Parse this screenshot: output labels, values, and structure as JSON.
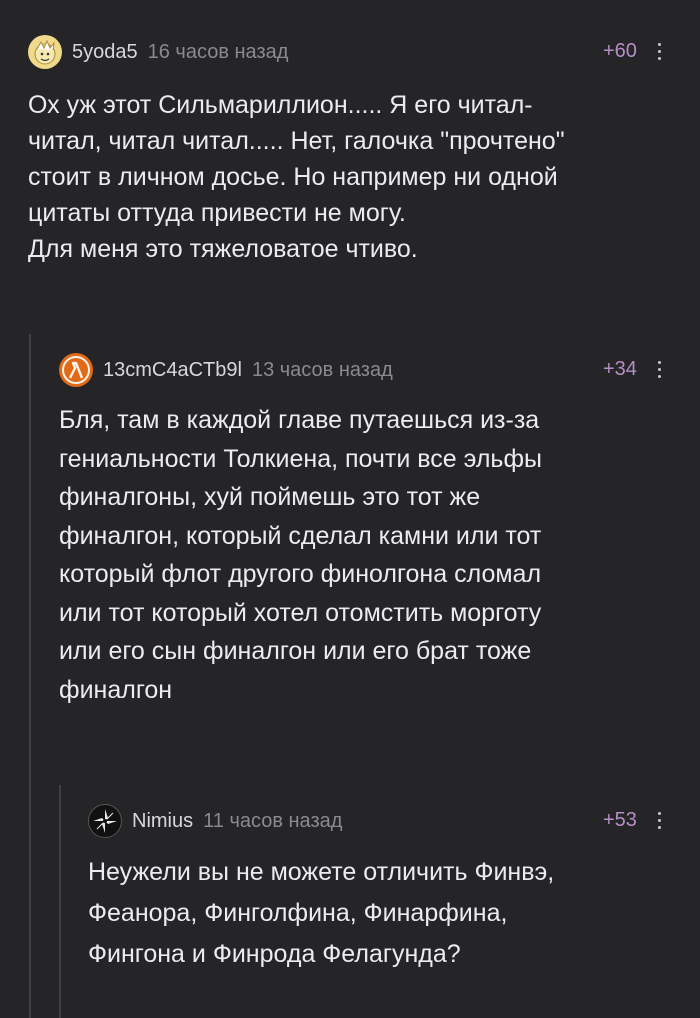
{
  "comments": [
    {
      "username": "5yoda5",
      "time": "16 часов назад",
      "rating": "+60",
      "text": "Ох уж этот Сильмариллион..... Я его читал-\nчитал, читал читал..... Нет, галочка \"прочтено\"\nстоит в личном досье. Но например ни одной\nцитаты оттуда привести не могу.\nДля меня это тяжеловатое чтиво.",
      "avatar_icon": "cartoon-face-icon"
    },
    {
      "username": "13cmC4aCTb9l",
      "time": "13 часов назад",
      "rating": "+34",
      "text": "Бля, там в каждой главе путаешься из-за\nгениальности Толкиена, почти все эльфы\nфиналгоны, хуй поймешь это тот же\nфиналгон, который сделал камни или тот\nкоторый флот другого финолгона сломал\nили тот который хотел отомстить морготу\nили его сын финалгон или его брат тоже\nфиналгон",
      "avatar_icon": "lambda-icon"
    },
    {
      "username": "Nimius",
      "time": "11 часов назад",
      "rating": "+53",
      "text": "Неужели вы не можете отличить Финвэ,\nФеанора, Финголфина, Финарфина,\nФингона и Финрода Фелагунда?",
      "avatar_icon": "shuriken-icon"
    }
  ],
  "colors": {
    "background": "#252528",
    "rating": "#b58ec4",
    "thread_line": "#3f3f45"
  }
}
